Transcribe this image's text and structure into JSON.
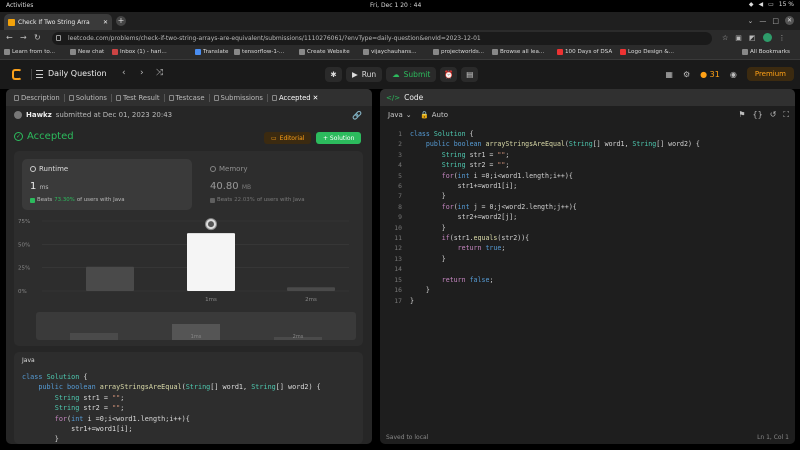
{
  "os": {
    "activities": "Activities",
    "clock": "Fri, Dec 1  20 : 44",
    "battery": "15 %"
  },
  "browser": {
    "tab_title": "Check If Two String Arra",
    "url": "leetcode.com/problems/check-if-two-string-arrays-are-equivalent/submissions/1110276061/?envType=daily-question&envId=2023-12-01",
    "bookmarks": [
      {
        "label": "Learn from to..."
      },
      {
        "label": "New chat"
      },
      {
        "label": "Inbox (1) - hari..."
      },
      {
        "label": "Translate"
      },
      {
        "label": "tensorflow-1-..."
      },
      {
        "label": "Create Website"
      },
      {
        "label": "vijaychauhans..."
      },
      {
        "label": "projectworlds..."
      },
      {
        "label": "Browse all lea..."
      },
      {
        "label": "100 Days of DSA"
      },
      {
        "label": "Logo Design &..."
      }
    ],
    "all_bookmarks": "All Bookmarks"
  },
  "lc": {
    "daily_question": "Daily Question",
    "run": "Run",
    "submit": "Submit",
    "streak": "31",
    "premium": "Premium"
  },
  "left": {
    "tabs": [
      "Description",
      "Solutions",
      "Test Result",
      "Testcase",
      "Submissions",
      "Accepted"
    ],
    "user": "Hawkz",
    "submitted": "submitted at Dec 01, 2023 20:43",
    "status": "Accepted",
    "editorial": "Editorial",
    "solution": "+ Solution",
    "runtime": {
      "label": "Runtime",
      "value": "1",
      "unit": "ms",
      "beats_prefix": "Beats",
      "beats_pct": "73.30%",
      "beats_suffix": "of users with Java"
    },
    "memory": {
      "label": "Memory",
      "value": "40.80",
      "unit": "MB",
      "beats_prefix": "Beats",
      "beats_pct": "22.03%",
      "beats_suffix": "of users with Java"
    },
    "code_lang": "Java"
  },
  "chart_data": {
    "type": "bar",
    "categories": [
      "",
      "1ms",
      "2ms"
    ],
    "values": [
      26,
      62,
      4
    ],
    "ylim": [
      0,
      75
    ],
    "yticks": [
      "0%",
      "25%",
      "50%",
      "75%"
    ],
    "xtick_labels": [
      "1ms",
      "2ms"
    ],
    "mini_labels": [
      "1ms",
      "2ms"
    ],
    "colors": {
      "bar": "#4a4a4a",
      "highlight": "#f5f5f5",
      "grid": "#3c3c3c"
    }
  },
  "editor": {
    "title": "Code",
    "lang": "Java",
    "auto": "Auto",
    "saved": "Saved to local",
    "cursor": "Ln 1, Col 1"
  }
}
